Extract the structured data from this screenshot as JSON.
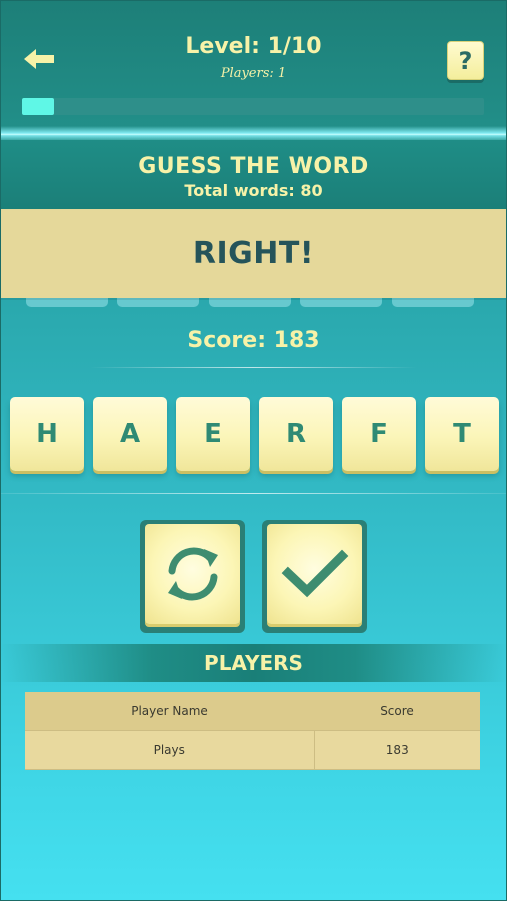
{
  "header": {
    "level": "Level: 1/10",
    "players": "Players: 1",
    "help_label": "?",
    "progress": 0.07
  },
  "game": {
    "title": "GUESS THE WORD",
    "total_words": "Total words: 80",
    "result": "RIGHT!",
    "score": "Score: 183",
    "letters": [
      "H",
      "A",
      "E",
      "R",
      "F",
      "T"
    ]
  },
  "players_section": {
    "title": "PLAYERS",
    "columns": [
      "Player Name",
      "Score"
    ],
    "rows": [
      [
        "Plays",
        "183"
      ]
    ]
  },
  "colors": {
    "accent_text": "#f7f2a8",
    "tile_letter": "#2f8a74",
    "banner_bg": "#e5d89a"
  }
}
